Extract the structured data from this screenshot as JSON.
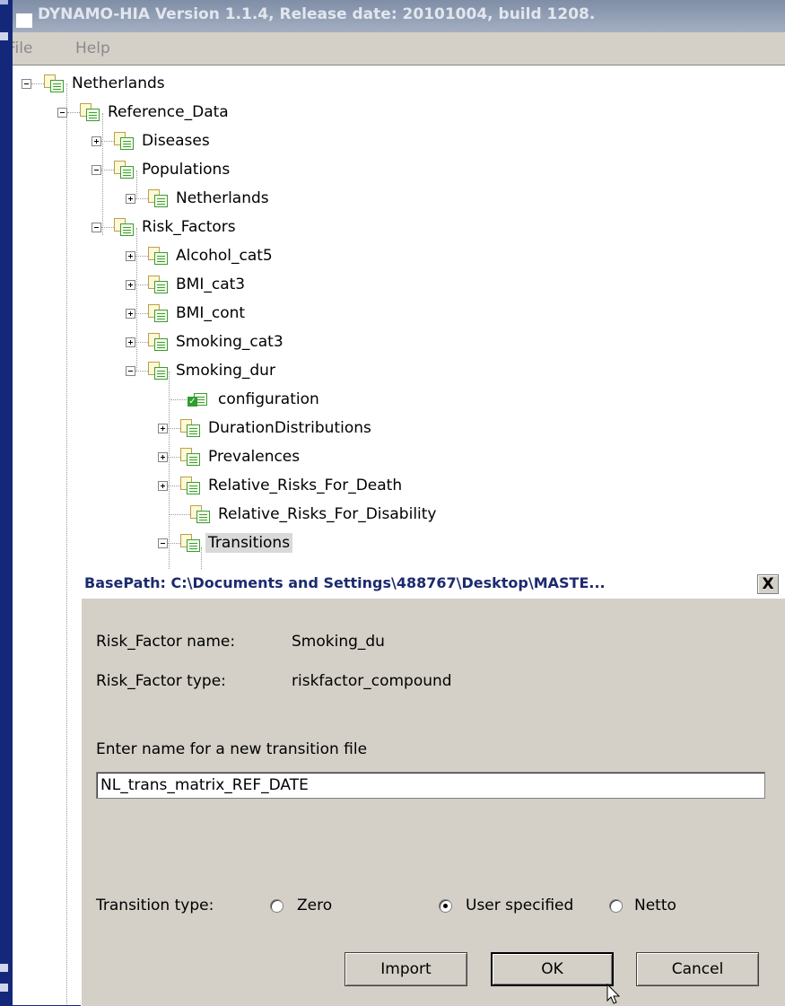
{
  "window": {
    "title": "DYNAMO-HIA Version 1.1.4, Release date: 20101004, build 1208."
  },
  "menu": {
    "items": [
      "File",
      "Help"
    ]
  },
  "tree": {
    "nodes": [
      {
        "label": "Netherlands",
        "expanded": true
      },
      {
        "label": "Reference_Data",
        "expanded": true
      },
      {
        "label": "Diseases",
        "expanded": false
      },
      {
        "label": "Populations",
        "expanded": true
      },
      {
        "label": "Netherlands",
        "expanded": false
      },
      {
        "label": "Risk_Factors",
        "expanded": true
      },
      {
        "label": "Alcohol_cat5",
        "expanded": false
      },
      {
        "label": "BMI_cat3",
        "expanded": false
      },
      {
        "label": "BMI_cont",
        "expanded": false
      },
      {
        "label": "Smoking_cat3",
        "expanded": false
      },
      {
        "label": "Smoking_dur",
        "expanded": true
      },
      {
        "label": "configuration",
        "leaf": true,
        "checked": true
      },
      {
        "label": "DurationDistributions",
        "expanded": false
      },
      {
        "label": "Prevalences",
        "expanded": false
      },
      {
        "label": "Relative_Risks_For_Death",
        "expanded": false
      },
      {
        "label": "Relative_Risks_For_Disability",
        "leaf": true
      },
      {
        "label": "Transitions",
        "expanded": true,
        "selected": true
      }
    ]
  },
  "dialog": {
    "title": "BasePath: C:\\Documents and Settings\\488767\\Desktop\\MASTE...",
    "close_label": "X",
    "risk_factor_name_label": "Risk_Factor name:",
    "risk_factor_name_value": "Smoking_du",
    "risk_factor_type_label": "Risk_Factor type:",
    "risk_factor_type_value": "riskfactor_compound",
    "prompt": "Enter name for a new transition file",
    "filename_value": "NL_trans_matrix_REF_DATE",
    "transition_type_label": "Transition type:",
    "options": [
      {
        "label": "Zero",
        "selected": false
      },
      {
        "label": "User specified",
        "selected": true
      },
      {
        "label": "Netto",
        "selected": false
      }
    ],
    "buttons": {
      "import": "Import",
      "ok": "OK",
      "cancel": "Cancel"
    }
  }
}
